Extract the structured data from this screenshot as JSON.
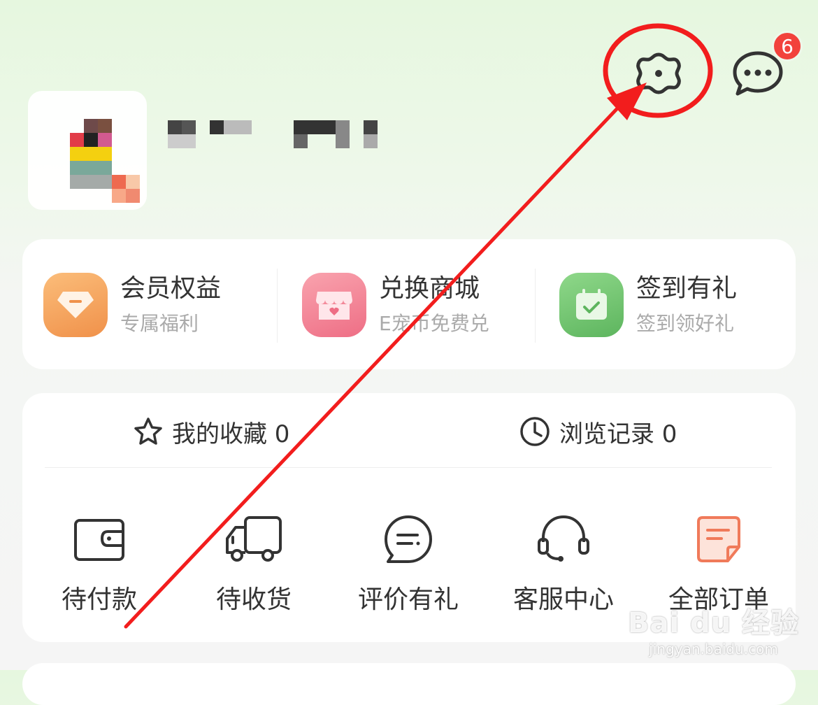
{
  "header": {
    "settings_icon": "gear-icon",
    "messages_icon": "chat-bubble-icon",
    "message_count": "6"
  },
  "benefits": [
    {
      "title": "会员权益",
      "sub": "专属福利",
      "icon": "diamond-icon",
      "color": "#f5a25a"
    },
    {
      "title": "兑换商城",
      "sub": "E宠币免费兑",
      "icon": "store-icon",
      "color": "#f27f92"
    },
    {
      "title": "签到有礼",
      "sub": "签到领好礼",
      "icon": "calendar-check-icon",
      "color": "#6cc56e"
    }
  ],
  "stats": {
    "favorites": "我的收藏 0",
    "history": "浏览记录 0"
  },
  "orders": [
    {
      "label": "待付款",
      "icon": "wallet-icon"
    },
    {
      "label": "待收货",
      "icon": "truck-icon"
    },
    {
      "label": "评价有礼",
      "icon": "comment-icon"
    },
    {
      "label": "客服中心",
      "icon": "headset-icon"
    },
    {
      "label": "全部订单",
      "icon": "order-list-icon",
      "color": "#f07a5a"
    }
  ],
  "watermark": {
    "main": "Bai du 经验",
    "sub": "jingyan.baidu.com"
  },
  "colors": {
    "accent_red": "#f2423c",
    "annotation_red": "#f21d1d"
  }
}
